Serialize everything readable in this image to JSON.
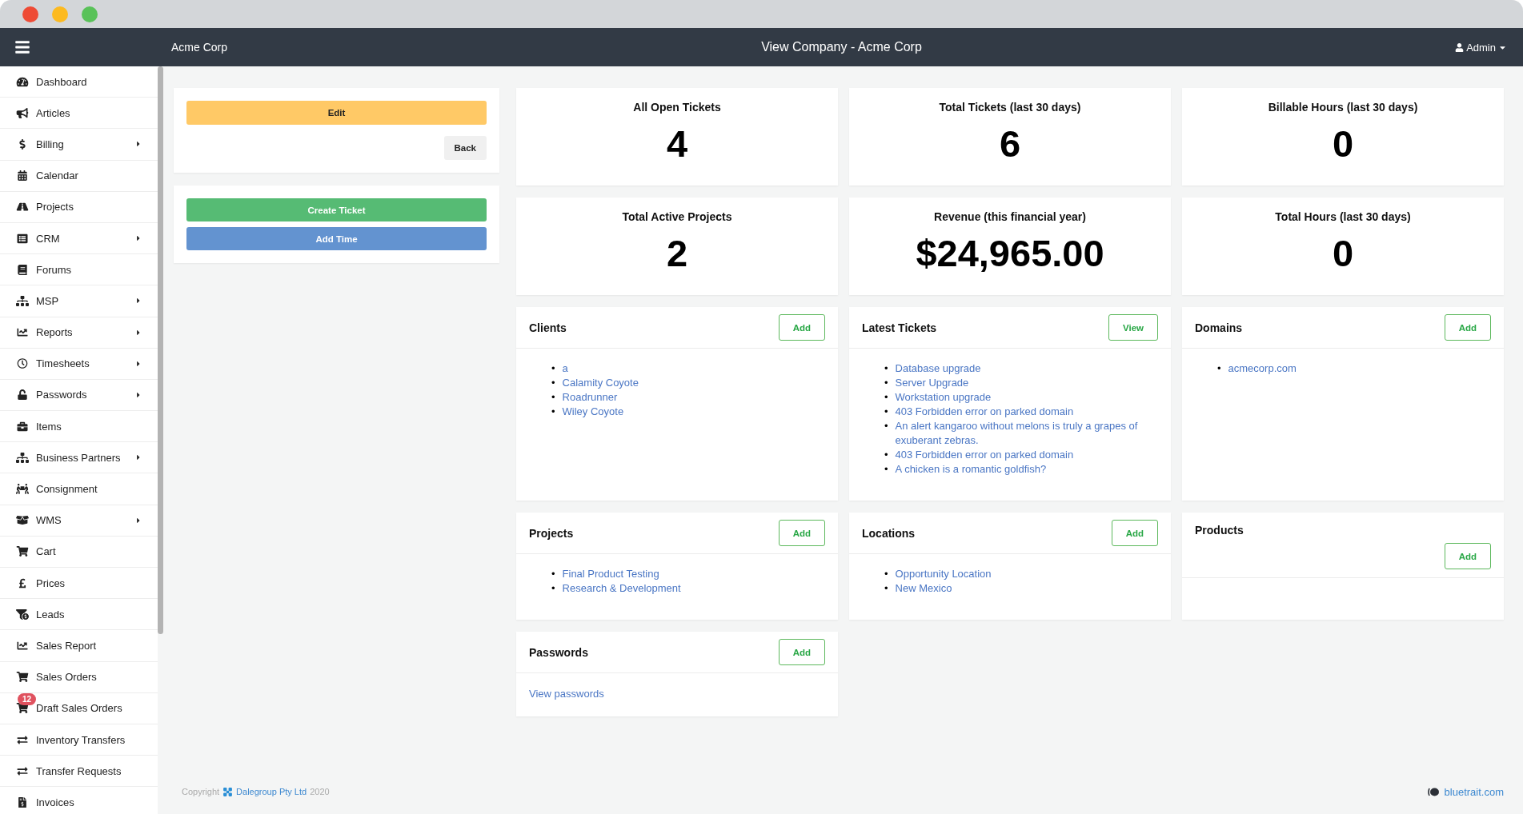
{
  "topbar": {
    "brand": "Acme Corp",
    "title": "View Company - Acme Corp",
    "user": "Admin"
  },
  "sidebar": {
    "items": [
      {
        "label": "Dashboard",
        "submenu": false
      },
      {
        "label": "Articles",
        "submenu": false
      },
      {
        "label": "Billing",
        "submenu": true
      },
      {
        "label": "Calendar",
        "submenu": false
      },
      {
        "label": "Projects",
        "submenu": false
      },
      {
        "label": "CRM",
        "submenu": true
      },
      {
        "label": "Forums",
        "submenu": false
      },
      {
        "label": "MSP",
        "submenu": true
      },
      {
        "label": "Reports",
        "submenu": true
      },
      {
        "label": "Timesheets",
        "submenu": true
      },
      {
        "label": "Passwords",
        "submenu": true
      },
      {
        "label": "Items",
        "submenu": false
      },
      {
        "label": "Business Partners",
        "submenu": true
      },
      {
        "label": "Consignment",
        "submenu": false
      },
      {
        "label": "WMS",
        "submenu": true
      },
      {
        "label": "Cart",
        "submenu": false
      },
      {
        "label": "Prices",
        "submenu": false
      },
      {
        "label": "Leads",
        "submenu": false
      },
      {
        "label": "Sales Report",
        "submenu": false
      },
      {
        "label": "Sales Orders",
        "submenu": false
      },
      {
        "label": "Draft Sales Orders",
        "submenu": false,
        "badge": "12"
      },
      {
        "label": "Inventory Transfers",
        "submenu": false
      },
      {
        "label": "Transfer Requests",
        "submenu": false
      },
      {
        "label": "Invoices",
        "submenu": false
      }
    ]
  },
  "actions": {
    "edit": "Edit",
    "back": "Back",
    "create_ticket": "Create Ticket",
    "add_time": "Add Time"
  },
  "stats": [
    {
      "label": "All Open Tickets",
      "value": "4"
    },
    {
      "label": "Total Tickets (last 30 days)",
      "value": "6"
    },
    {
      "label": "Billable Hours (last 30 days)",
      "value": "0"
    },
    {
      "label": "Total Active Projects",
      "value": "2"
    },
    {
      "label": "Revenue (this financial year)",
      "value": "$24,965.00"
    },
    {
      "label": "Total Hours (last 30 days)",
      "value": "0"
    }
  ],
  "panels": [
    {
      "kind": "list",
      "bullet": "•",
      "title": "Clients",
      "button": "Add",
      "items": [
        "a",
        "Calamity Coyote",
        "Roadrunner",
        "Wiley Coyote"
      ]
    },
    {
      "kind": "list",
      "bullet": "•",
      "title": "Latest Tickets",
      "button": "View",
      "items": [
        "Database upgrade",
        "Server Upgrade",
        "Workstation upgrade",
        "403 Forbidden error on parked domain",
        "An alert kangaroo without melons is truly a grapes of exuberant zebras.",
        "403 Forbidden error on parked domain",
        "A chicken is a romantic goldfish?"
      ]
    },
    {
      "kind": "list",
      "bullet": "•",
      "title": "Domains",
      "button": "Add",
      "items": [
        "acmecorp.com"
      ]
    },
    {
      "kind": "list",
      "bullet": "•",
      "title": "Projects",
      "button": "Add",
      "items": [
        "Final Product Testing",
        "Research & Development"
      ]
    },
    {
      "kind": "list",
      "bullet": "•",
      "title": "Locations",
      "button": "Add",
      "items": [
        "Opportunity Location",
        "New Mexico"
      ]
    },
    {
      "kind": "wrapped",
      "title": "Products",
      "button": "Add"
    },
    {
      "kind": "link",
      "title": "Passwords",
      "button": "Add",
      "link": "View passwords"
    }
  ],
  "footer": {
    "prefix": "Copyright",
    "company": "Dalegroup Pty Ltd",
    "year": "2020",
    "vendor": "bluetrait.com"
  }
}
